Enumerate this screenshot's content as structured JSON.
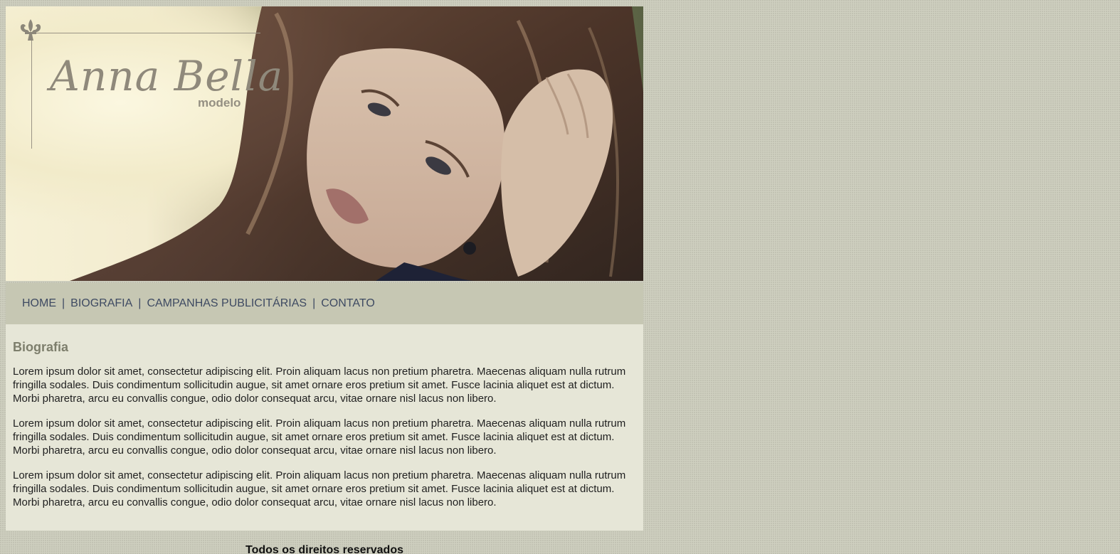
{
  "header": {
    "logo_title": "Anna Bella",
    "logo_subtitle": "modelo",
    "logo_icon": "fleur-de-lis-icon",
    "photo": "model-portrait-photo"
  },
  "nav": {
    "items": [
      {
        "label": "HOME"
      },
      {
        "label": "BIOGRAFIA"
      },
      {
        "label": "CAMPANHAS PUBLICITÁRIAS"
      },
      {
        "label": "CONTATO"
      }
    ],
    "separator": "|"
  },
  "main": {
    "title": "Biografia",
    "paragraphs": [
      "Lorem ipsum dolor sit amet, consectetur adipiscing elit. Proin aliquam lacus non pretium pharetra. Maecenas aliquam nulla rutrum fringilla sodales. Duis condimentum sollicitudin augue, sit amet ornare eros pretium sit amet. Fusce lacinia aliquet est at dictum. Morbi pharetra, arcu eu convallis congue, odio dolor consequat arcu, vitae ornare nisl lacus non libero.",
      "Lorem ipsum dolor sit amet, consectetur adipiscing elit. Proin aliquam lacus non pretium pharetra. Maecenas aliquam nulla rutrum fringilla sodales. Duis condimentum sollicitudin augue, sit amet ornare eros pretium sit amet. Fusce lacinia aliquet est at dictum. Morbi pharetra, arcu eu convallis congue, odio dolor consequat arcu, vitae ornare nisl lacus non libero.",
      "Lorem ipsum dolor sit amet, consectetur adipiscing elit. Proin aliquam lacus non pretium pharetra. Maecenas aliquam nulla rutrum fringilla sodales. Duis condimentum sollicitudin augue, sit amet ornare eros pretium sit amet. Fusce lacinia aliquet est at dictum. Morbi pharetra, arcu eu convallis congue, odio dolor consequat arcu, vitae ornare nisl lacus non libero."
    ]
  },
  "footer": {
    "text": "Todos os direitos reservados"
  },
  "colors": {
    "page_bg": "#cfd0c0",
    "nav_bg": "#c6c7b3",
    "nav_link": "#3e4a62",
    "content_bg": "#e6e6d7",
    "heading": "#7d7e6c"
  }
}
